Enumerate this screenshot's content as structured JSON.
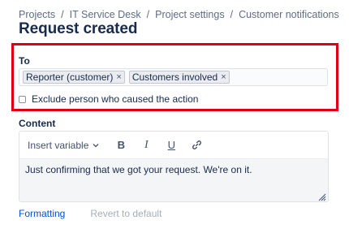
{
  "breadcrumb": {
    "items": [
      "Projects",
      "IT Service Desk",
      "Project settings",
      "Customer notifications"
    ],
    "separator": "/"
  },
  "page": {
    "title": "Request created"
  },
  "recipients": {
    "label": "To",
    "tags": [
      {
        "label": "Reporter (customer)",
        "remove": "×"
      },
      {
        "label": "Customers involved",
        "remove": "×"
      }
    ],
    "exclude_label": "Exclude person who caused the action",
    "exclude_checked": false
  },
  "content": {
    "label": "Content",
    "toolbar": {
      "insert_variable": "Insert variable",
      "bold": "B",
      "italic": "I",
      "underline": "U"
    },
    "body_text": "Just confirming that we got your request. We're on it."
  },
  "footer": {
    "formatting": "Formatting",
    "revert": "Revert to default"
  },
  "colors": {
    "highlight": "#e00012",
    "link": "#0052cc",
    "disabled": "#a5adba"
  }
}
